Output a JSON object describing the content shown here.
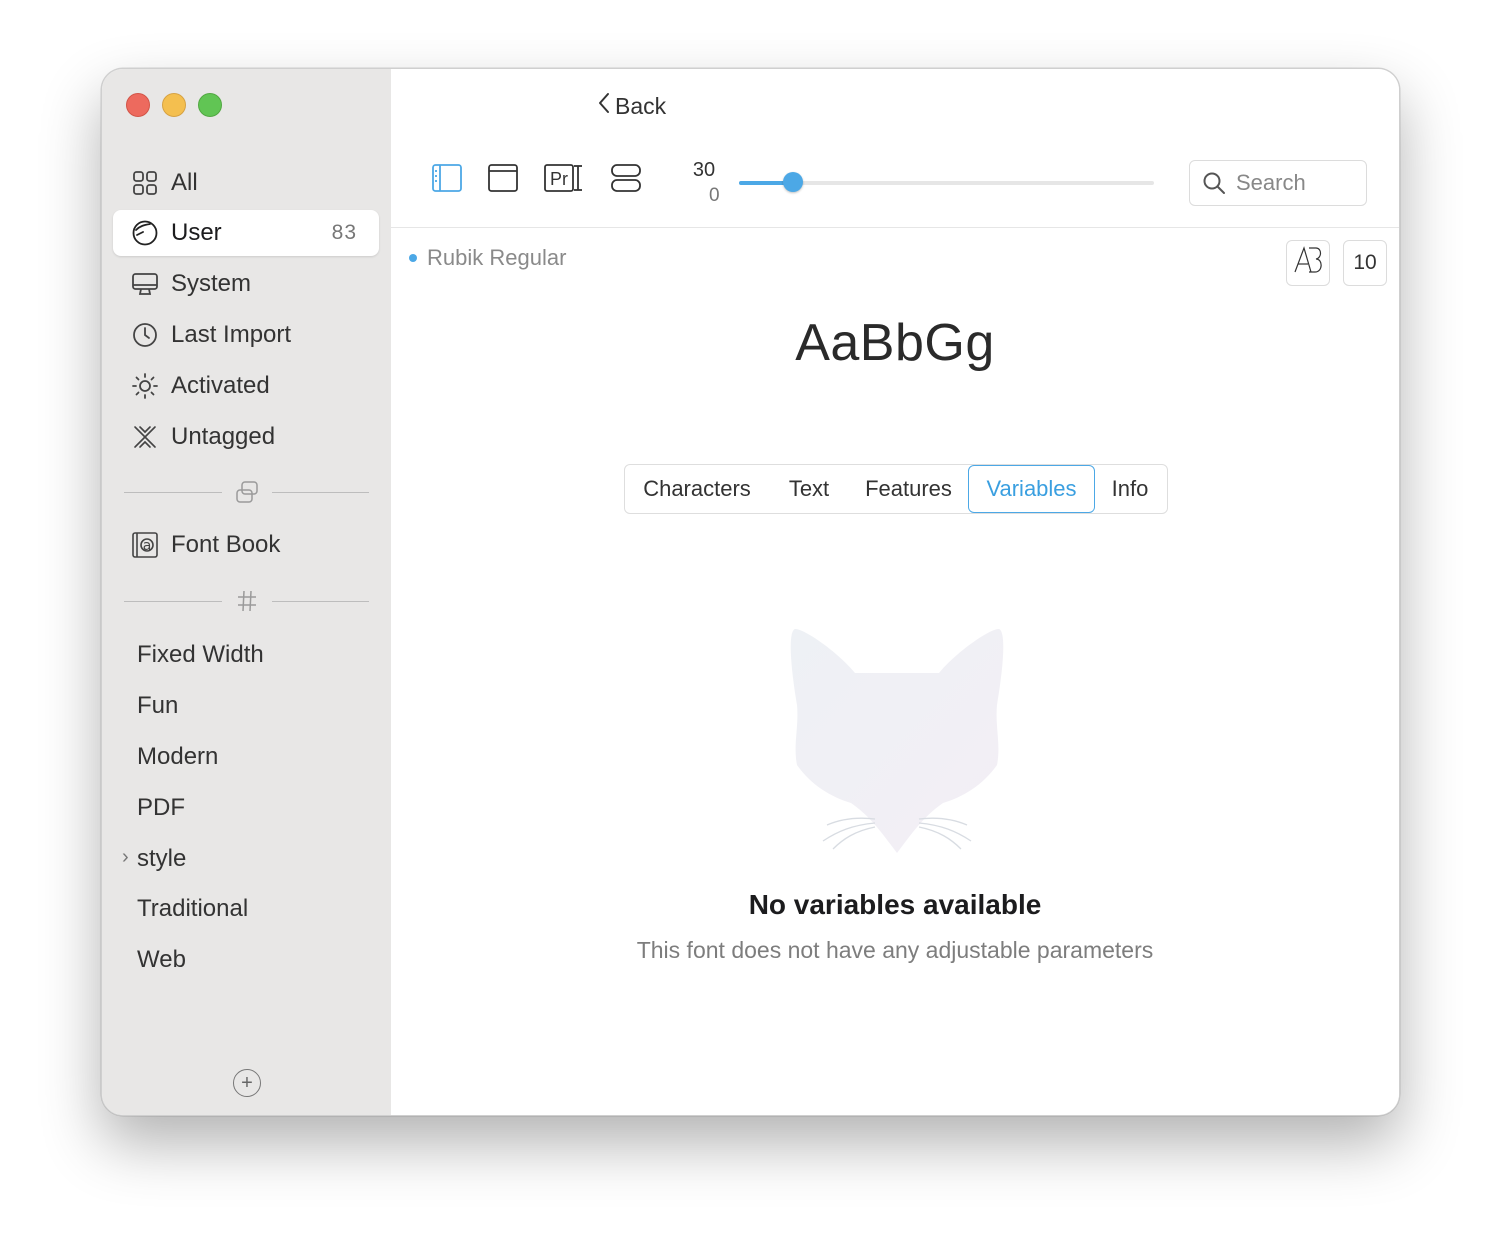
{
  "window": {
    "controls": [
      "close",
      "minimize",
      "zoom"
    ]
  },
  "sidebar": {
    "items": [
      {
        "label": "All",
        "icon": "grid-icon"
      },
      {
        "label": "User",
        "icon": "user-icon",
        "count": "83",
        "selected": true
      },
      {
        "label": "System",
        "icon": "monitor-icon"
      },
      {
        "label": "Last Import",
        "icon": "clock-icon"
      },
      {
        "label": "Activated",
        "icon": "sun-icon"
      },
      {
        "label": "Untagged",
        "icon": "untagged-icon"
      }
    ],
    "collections": [
      {
        "label": "Font Book",
        "icon": "font-book-icon"
      }
    ],
    "tags": [
      {
        "label": "Fixed Width"
      },
      {
        "label": "Fun"
      },
      {
        "label": "Modern"
      },
      {
        "label": "PDF"
      },
      {
        "label": "style",
        "expandable": true
      },
      {
        "label": "Traditional"
      },
      {
        "label": "Web"
      }
    ]
  },
  "header": {
    "back_label": "Back"
  },
  "toolbar": {
    "view_modes": [
      "sidebar-view-icon",
      "window-view-icon",
      "text-preview-icon",
      "list-view-icon"
    ],
    "active_view": "sidebar-view-icon",
    "size_value": "30",
    "size_min": "0",
    "size_fraction": 0.13,
    "search_placeholder": "Search"
  },
  "font": {
    "name": "Rubik Regular",
    "preview": "AaBbGg",
    "size_box": "10"
  },
  "tabs": [
    {
      "label": "Characters"
    },
    {
      "label": "Text"
    },
    {
      "label": "Features"
    },
    {
      "label": "Variables",
      "active": true
    },
    {
      "label": "Info"
    }
  ],
  "empty_state": {
    "title": "No variables available",
    "subtitle": "This font does not have any adjustable parameters"
  },
  "colors": {
    "accent": "#4ca8e6",
    "sidebar_bg": "#e8e7e6"
  }
}
